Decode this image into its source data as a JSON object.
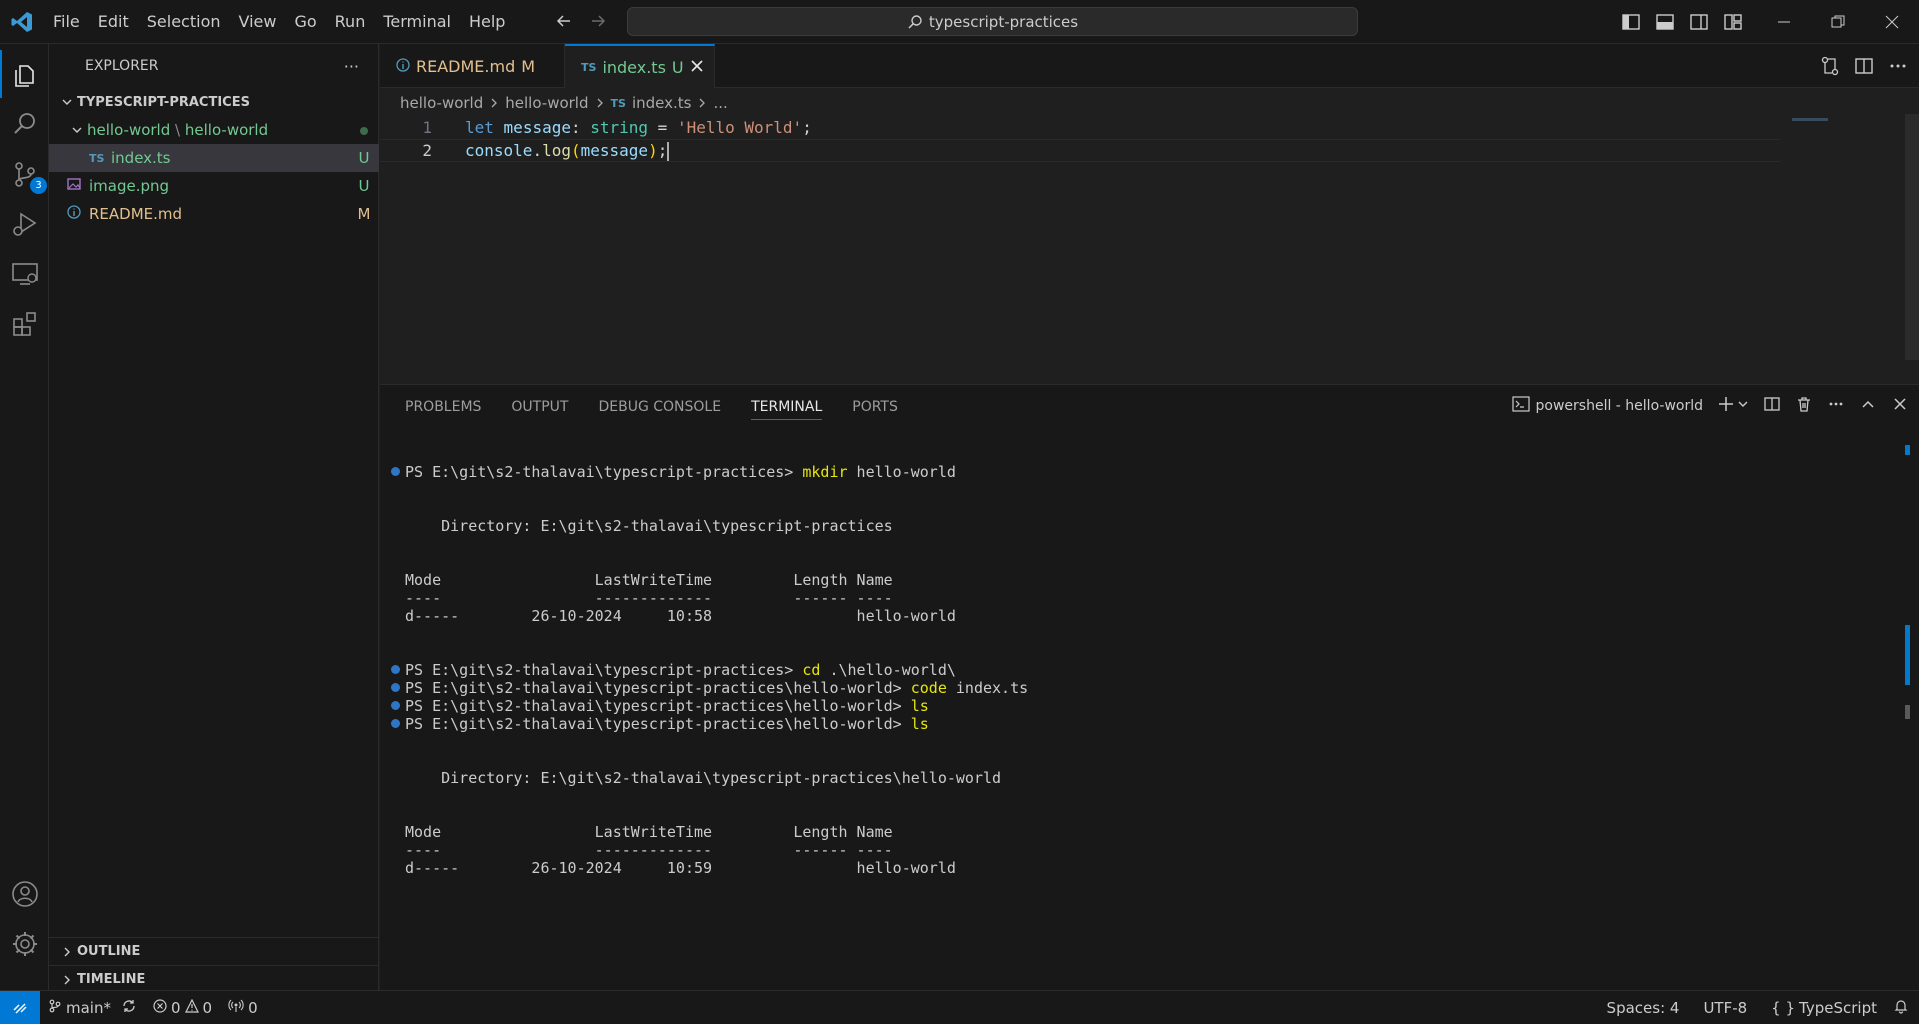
{
  "menu": [
    "File",
    "Edit",
    "Selection",
    "View",
    "Go",
    "Run",
    "Terminal",
    "Help"
  ],
  "search": {
    "text": "typescript-practices"
  },
  "activity": {
    "scm_badge": "3"
  },
  "explorer": {
    "title": "EXPLORER",
    "more": "···",
    "root": "TYPESCRIPT-PRACTICES",
    "folder_a": "hello-world",
    "folder_sep": "\\",
    "folder_b": "hello-world",
    "files": [
      {
        "icon": "TS",
        "name": "index.ts",
        "status": "U"
      },
      {
        "name": "image.png",
        "status": "U"
      },
      {
        "name": "README.md",
        "status": "M"
      }
    ],
    "outline": "OUTLINE",
    "timeline": "TIMELINE"
  },
  "tabs": [
    {
      "label": "README.md",
      "status": "M"
    },
    {
      "icon": "TS",
      "label": "index.ts",
      "status": "U"
    }
  ],
  "breadcrumb": [
    "hello-world",
    "hello-world",
    "index.ts",
    "..."
  ],
  "editor": {
    "line_numbers": [
      "1",
      "2"
    ],
    "line1": {
      "kw": "let",
      "var": "message",
      "colon": ": ",
      "type": "string",
      "eq": " = ",
      "str": "'Hello World'",
      "semi": ";"
    },
    "line2": {
      "obj": "console",
      "dot": ".",
      "fn": "log",
      "open": "(",
      "arg": "message",
      "close": ")",
      "semi": ";"
    }
  },
  "panel": {
    "tabs": [
      "PROBLEMS",
      "OUTPUT",
      "DEBUG CONSOLE",
      "TERMINAL",
      "PORTS"
    ],
    "shell": "powershell - hello-world"
  },
  "terminal": [
    {
      "prompt": "PS E:\\git\\s2-thalavai\\typescript-practices> ",
      "cmd": "mkdir",
      "rest": " hello-world",
      "dot": true
    },
    {
      "text": "    Directory: E:\\git\\s2-thalavai\\typescript-practices"
    },
    {
      "text": "Mode                 LastWriteTime         Length Name"
    },
    {
      "text": "----                 -------------         ------ ----"
    },
    {
      "text": "d-----        26-10-2024     10:58                hello-world"
    },
    {
      "prompt": "PS E:\\git\\s2-thalavai\\typescript-practices> ",
      "cmd": "cd",
      "rest": " .\\hello-world\\",
      "dot": true
    },
    {
      "prompt": "PS E:\\git\\s2-thalavai\\typescript-practices\\hello-world> ",
      "cmd": "code",
      "rest": " index.ts",
      "dot": true
    },
    {
      "prompt": "PS E:\\git\\s2-thalavai\\typescript-practices\\hello-world> ",
      "cmd": "ls",
      "rest": "",
      "dot": true
    },
    {
      "prompt": "PS E:\\git\\s2-thalavai\\typescript-practices\\hello-world> ",
      "cmd": "ls",
      "rest": "",
      "dot": true
    },
    {
      "text": "    Directory: E:\\git\\s2-thalavai\\typescript-practices\\hello-world"
    },
    {
      "text": "Mode                 LastWriteTime         Length Name"
    },
    {
      "text": "----                 -------------         ------ ----"
    },
    {
      "text": "d-----        26-10-2024     10:59                hello-world"
    }
  ],
  "status": {
    "branch": "main*",
    "errors": "0",
    "warnings": "0",
    "ports": "0",
    "spaces": "Spaces: 4",
    "encoding": "UTF-8",
    "language_braces": "{ }",
    "language": "TypeScript"
  },
  "colors": {
    "accent": "#0078d4",
    "untracked": "#73c991",
    "modified": "#e2c08d"
  }
}
